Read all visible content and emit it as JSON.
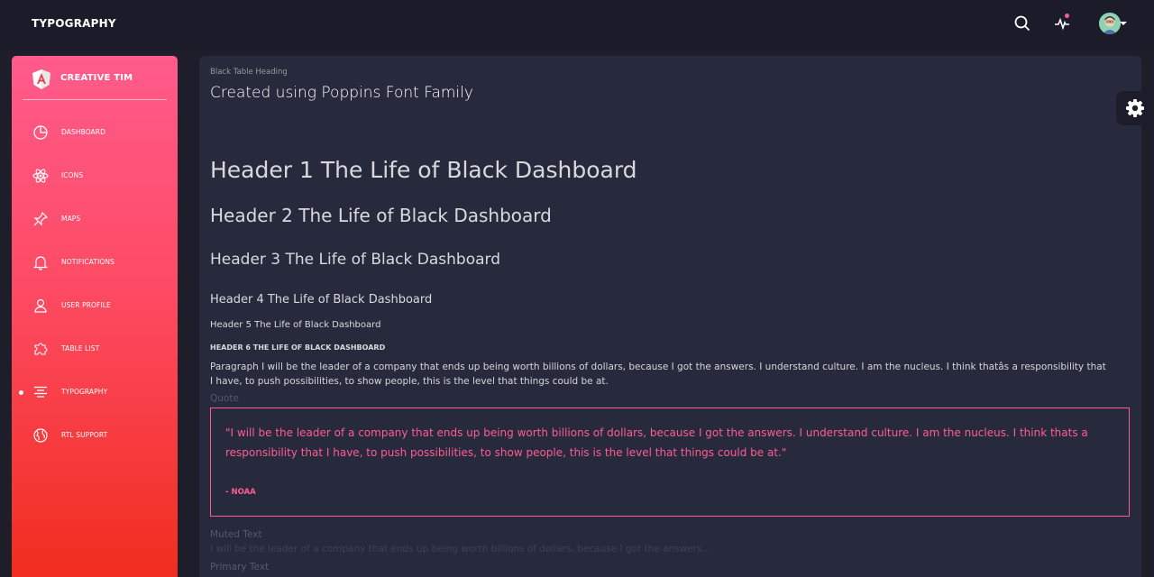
{
  "navbar": {
    "brand": "TYPOGRAPHY",
    "icons": [
      "search-icon",
      "activity-icon",
      "avatar"
    ],
    "notification_color": "#fd5d93"
  },
  "sidebar": {
    "logo_text": "CREATIVE TIM",
    "logo_icon": "angular-logo-icon",
    "items": [
      {
        "label": "DASHBOARD",
        "icon": "chart-pie-icon"
      },
      {
        "label": "ICONS",
        "icon": "atom-icon"
      },
      {
        "label": "MAPS",
        "icon": "pin-icon"
      },
      {
        "label": "NOTIFICATIONS",
        "icon": "bell-icon"
      },
      {
        "label": "USER PROFILE",
        "icon": "user-icon"
      },
      {
        "label": "TABLE LIST",
        "icon": "puzzle-icon"
      },
      {
        "label": "TYPOGRAPHY",
        "icon": "align-center-icon",
        "active": true
      },
      {
        "label": "RTL SUPPORT",
        "icon": "world-icon"
      }
    ],
    "gradient_top": "#ff5b8c",
    "gradient_bottom": "#f02d1e"
  },
  "card": {
    "category": "Black Table Heading",
    "title": "Created using Poppins Font Family",
    "h1": "Header 1 The Life of Black Dashboard",
    "h2": "Header 2 The Life of Black Dashboard",
    "h3": "Header 3 The Life of Black Dashboard",
    "h4": "Header 4 The Life of Black Dashboard",
    "h5": "Header 5 The Life of Black Dashboard",
    "h6": "Header 6 The Life of Black Dashboard",
    "paragraph": "Paragraph I will be the leader of a company that ends up being worth billions of dollars, because I got the answers. I understand culture. I am the nucleus. I think thatâs a responsibility that I have, to push possibilities, to show people, this is the level that things could be at.",
    "quote_label": "Quote",
    "quote_text": "\"I will be the leader of a company that ends up being worth billions of dollars, because I got the answers. I understand culture. I am the nucleus. I think thats a responsibility that I have, to push possibilities, to show people, this is the level that things could be at.\"",
    "quote_author": "- NOAA",
    "muted_label": "Muted Text",
    "muted_text": "I will be the leader of a company that ends up being worth billions of dollars, because I got the answers...",
    "primary_label": "Primary Text"
  },
  "fixed_plugin": {
    "icon": "gear-icon"
  },
  "colors": {
    "accent": "#fd5d93",
    "card_bg": "#27293d",
    "page_bg": "#1e1e2b"
  }
}
